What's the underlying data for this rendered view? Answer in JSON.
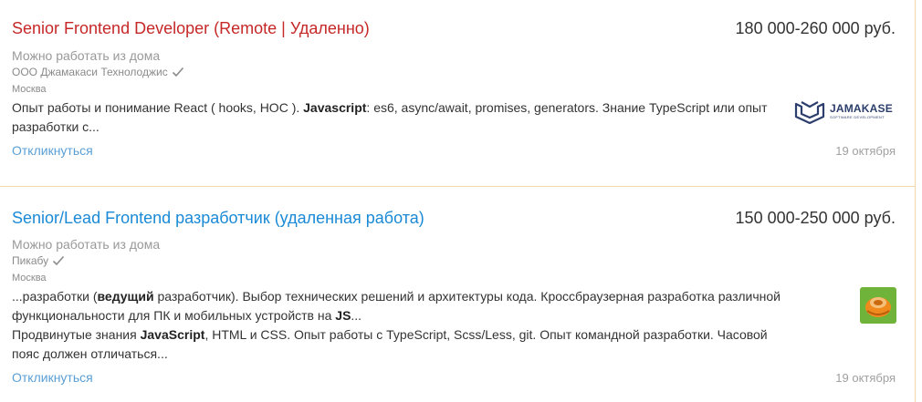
{
  "vacancies": [
    {
      "title": "Senior Frontend Developer (Remote | Удаленно)",
      "salary": "180 000-260 000 руб.",
      "remote": "Можно работать из дома",
      "company": "ООО Джамакаси Технолоджис",
      "city": "Москва",
      "desc_parts": {
        "p1": "Опыт работы и понимание React ( hooks, HOC ). ",
        "b1": "Javascript",
        "p2": ": es6, async/await, promises, generators. Знание TypeScript или опыт разработки с..."
      },
      "respond_label": "Откликнуться",
      "date": "19 октября",
      "logo": {
        "icon": "jamakase-logo-icon",
        "brand": "JAMAKASE",
        "tagline": "SOFTWARE DEVELOPMENT",
        "color": "#2c3e6b"
      },
      "title_color": "#c62828"
    },
    {
      "title": "Senior/Lead Frontend разработчик (удаленная работа)",
      "salary": "150 000-250 000 руб.",
      "remote": "Можно работать из дома",
      "company": "Пикабу",
      "city": "Москва",
      "desc_parts": {
        "p1": "...разработки (",
        "b1": "ведущий",
        "p2": " разработчик). Выбор технических решений и архитектуры кода. Кроссбраузерная разработка различной функциональности для ПК и мобильных устройств на ",
        "b2": "JS",
        "p3": "...",
        "p4": "Продвинутые знания ",
        "b3": "JavaScript",
        "p5": ", HTML и CSS. Опыт работы с TypeScript, Scss/Less, git. Опыт командной разработки. Часовой пояс должен отличаться..."
      },
      "respond_label": "Откликнуться",
      "date": "19 октября",
      "logo": {
        "icon": "pikabu-logo-icon",
        "colors": [
          "#6fb33a",
          "#f08a1c"
        ]
      },
      "title_color": "#1a8ad6"
    }
  ],
  "colors": {
    "link": "#5a9fd4",
    "divider": "#f1d8a8",
    "muted": "#999999"
  }
}
